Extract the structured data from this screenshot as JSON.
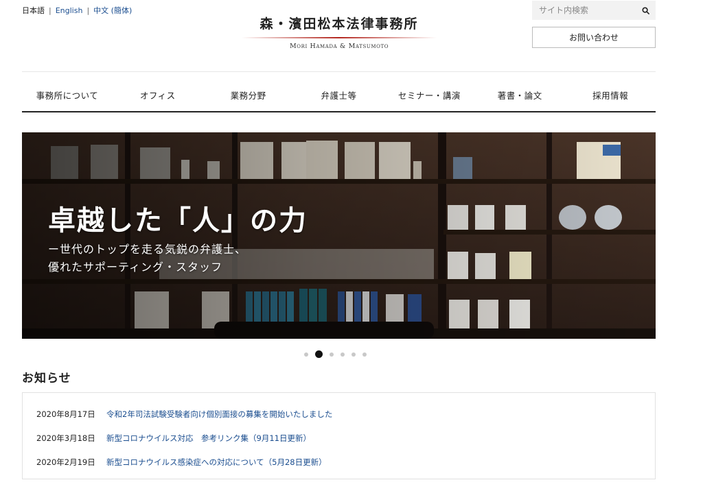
{
  "lang_bar": {
    "current": "日本語",
    "english": "English",
    "chinese": "中文 (簡体)",
    "separator": "|"
  },
  "logo": {
    "japanese": "森・濱田松本法律事務所",
    "english": "Mori Hamada & Matsumoto"
  },
  "search": {
    "placeholder": "サイト内検索",
    "icon": "search-icon"
  },
  "contact_label": "お問い合わせ",
  "nav": {
    "items": [
      {
        "label": "事務所について"
      },
      {
        "label": "オフィス"
      },
      {
        "label": "業務分野"
      },
      {
        "label": "弁護士等"
      },
      {
        "label": "セミナー・講演"
      },
      {
        "label": "著書・論文"
      },
      {
        "label": "採用情報"
      }
    ]
  },
  "hero": {
    "headline": "卓越した「人」の力",
    "sub_line1": "ー世代のトップを走る気鋭の弁護士、",
    "sub_line2": "優れたサポーティング・スタッフ",
    "slides_total": 6,
    "active_slide": 2
  },
  "news": {
    "title": "お知らせ",
    "items": [
      {
        "date": "2020年8月17日",
        "text": "令和2年司法試験受験者向け個別面接の募集を開始いたしました"
      },
      {
        "date": "2020年3月18日",
        "text": "新型コロナウイルス対応　参考リンク集（9月11日更新）"
      },
      {
        "date": "2020年2月19日",
        "text": "新型コロナウイルス感染症への対応について（5月28日更新）"
      }
    ]
  },
  "colors": {
    "link": "#1a4d8f",
    "logo_rule": "#b3261e",
    "nav_rule": "#222222"
  }
}
